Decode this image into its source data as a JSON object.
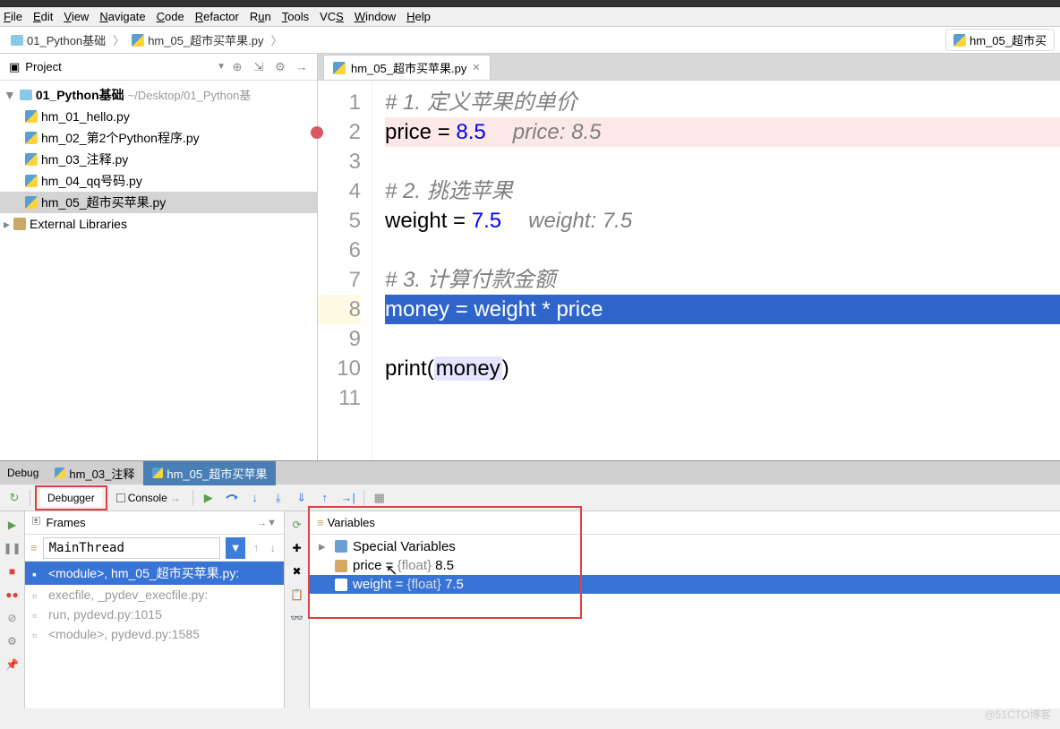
{
  "menu": [
    "File",
    "Edit",
    "View",
    "Navigate",
    "Code",
    "Refactor",
    "Run",
    "Tools",
    "VCS",
    "Window",
    "Help"
  ],
  "breadcrumb": {
    "project": "01_Python基础",
    "file": "hm_05_超市买苹果.py"
  },
  "tab_right": "hm_05_超市买",
  "sidebar": {
    "title": "Project",
    "root": "01_Python基础",
    "root_path": "~/Desktop/01_Python基",
    "files": [
      "hm_01_hello.py",
      "hm_02_第2个Python程序.py",
      "hm_03_注释.py",
      "hm_04_qq号码.py",
      "hm_05_超市买苹果.py"
    ],
    "ext_lib": "External Libraries"
  },
  "editor": {
    "tab": "hm_05_超市买苹果.py",
    "lines": {
      "1": {
        "comment": "# 1. 定义苹果的单价"
      },
      "2": {
        "code": "price = ",
        "num": "8.5",
        "hint": "price: 8.5"
      },
      "3": {
        "code": ""
      },
      "4": {
        "comment": "# 2. 挑选苹果"
      },
      "5": {
        "code": "weight = ",
        "num": "7.5",
        "hint": "weight: 7.5"
      },
      "6": {
        "code": ""
      },
      "7": {
        "comment": "# 3. 计算付款金额"
      },
      "8": {
        "code": "money = weight * price"
      },
      "9": {
        "code": ""
      },
      "10": {
        "func": "print",
        "paren_open": "(",
        "param": "money",
        "paren_close": ")"
      },
      "11": {
        "code": ""
      }
    }
  },
  "debug": {
    "main_tab": "Debug",
    "file_tabs": [
      "hm_03_注释",
      "hm_05_超市买苹果"
    ],
    "sub_tabs": {
      "debugger": "Debugger",
      "console": "Console"
    },
    "frames": {
      "title": "Frames",
      "thread": "MainThread",
      "items": [
        "<module>, hm_05_超市买苹果.py:",
        "execfile, _pydev_execfile.py:",
        "run, pydevd.py:1015",
        "<module>, pydevd.py:1585"
      ]
    },
    "variables": {
      "title": "Variables",
      "special": "Special Variables",
      "items": [
        {
          "name": "price",
          "type": "{float}",
          "val": "8.5"
        },
        {
          "name": "weight",
          "type": "{float}",
          "val": "7.5"
        }
      ]
    }
  },
  "watermark": "@51CTO博客"
}
